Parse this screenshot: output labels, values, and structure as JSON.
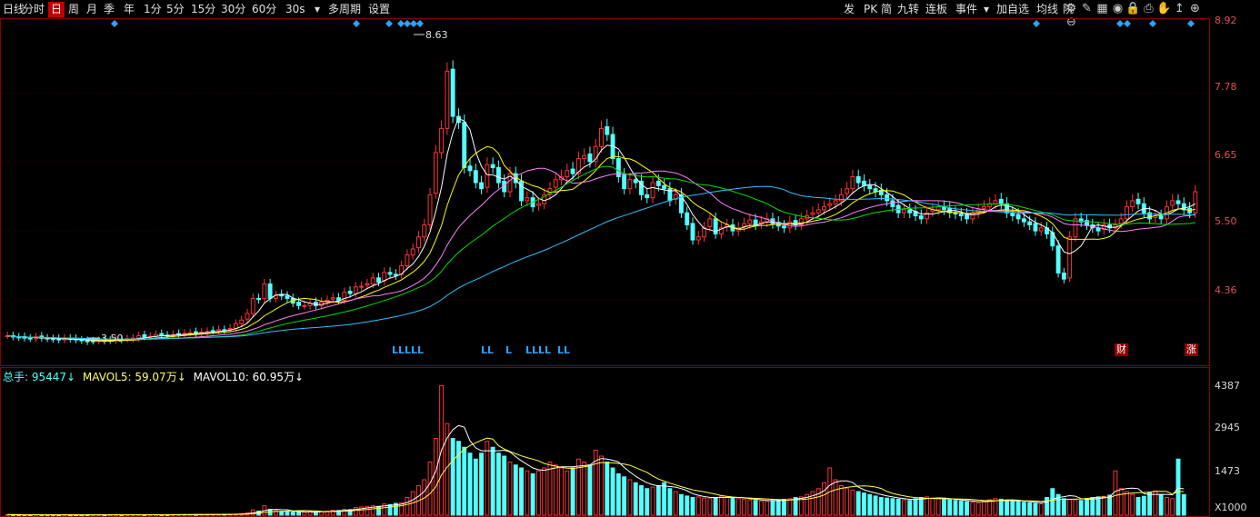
{
  "toolbar": {
    "items": [
      "日线",
      "分时",
      "日",
      "周",
      "月",
      "季",
      "年",
      "1分",
      "5分",
      "15分",
      "30分",
      "60分",
      "30s",
      "多周期",
      "设置"
    ],
    "active_index": 2,
    "right_items": [
      "发",
      "PK",
      "简",
      "九转",
      "连板",
      "事件",
      "加自选",
      "均线",
      "院"
    ]
  },
  "price_axis": {
    "labels": [
      "8.92",
      "7.78",
      "6.65",
      "5.50",
      "4.36"
    ]
  },
  "volume_axis": {
    "labels": [
      "4387",
      "2945",
      "1473",
      "X1000"
    ]
  },
  "volume_legend": {
    "total_label": "总手: 95447↓",
    "mavol5_label": "MAVOL5: 59.07万↓",
    "mavol10_label": "MAVOL10: 60.95万↓"
  },
  "annotations": {
    "high_label": "8.63",
    "low_label": "3.50",
    "ll_groups": [
      "LLLLL",
      "LL",
      "L",
      "LLLL",
      "LL"
    ],
    "tag_finance": "财",
    "tag_up": "涨"
  },
  "colors": {
    "up": "#ff3333",
    "down": "#54ffff",
    "ma5": "#ffffff",
    "ma10": "#ffff00",
    "ma20": "#ff80ff",
    "ma30": "#00e000",
    "ma60": "#30c0ff",
    "frame": "#8b0000"
  },
  "chart_data": {
    "type": "candlestick",
    "price_range": [
      3.3,
      9.0
    ],
    "volume_range": [
      0,
      4400
    ],
    "volume_unit": "X1000",
    "closes": [
      3.76,
      3.74,
      3.73,
      3.72,
      3.71,
      3.74,
      3.72,
      3.71,
      3.7,
      3.69,
      3.72,
      3.7,
      3.69,
      3.68,
      3.66,
      3.67,
      3.68,
      3.67,
      3.68,
      3.7,
      3.69,
      3.71,
      3.72,
      3.76,
      3.74,
      3.75,
      3.78,
      3.77,
      3.76,
      3.78,
      3.79,
      3.8,
      3.81,
      3.8,
      3.82,
      3.83,
      3.84,
      3.86,
      3.85,
      3.88,
      3.96,
      4.02,
      4.13,
      4.38,
      4.36,
      4.62,
      4.38,
      4.43,
      4.42,
      4.38,
      4.3,
      4.26,
      4.26,
      4.3,
      4.26,
      4.32,
      4.35,
      4.39,
      4.35,
      4.48,
      4.46,
      4.57,
      4.58,
      4.62,
      4.72,
      4.65,
      4.81,
      4.78,
      4.76,
      4.92,
      5.1,
      5.2,
      5.4,
      5.6,
      6.1,
      6.8,
      7.2,
      8.15,
      7.4,
      7.3,
      6.55,
      6.5,
      6.3,
      6.2,
      6.6,
      6.55,
      6.3,
      6.15,
      6.45,
      6.3,
      6.0,
      6.05,
      5.9,
      5.95,
      6.1,
      6.2,
      6.35,
      6.4,
      6.5,
      6.45,
      6.7,
      6.75,
      6.65,
      6.9,
      7.2,
      7.1,
      6.7,
      6.4,
      6.2,
      6.35,
      6.3,
      6.1,
      6.05,
      6.3,
      6.25,
      6.2,
      6.0,
      6.1,
      5.8,
      5.6,
      5.35,
      5.4,
      5.55,
      5.7,
      5.45,
      5.55,
      5.6,
      5.5,
      5.55,
      5.62,
      5.68,
      5.6,
      5.65,
      5.7,
      5.62,
      5.58,
      5.55,
      5.65,
      5.6,
      5.7,
      5.75,
      5.8,
      5.85,
      5.9,
      5.95,
      6.0,
      6.1,
      6.2,
      6.4,
      6.3,
      6.25,
      6.2,
      6.15,
      6.1,
      6.0,
      5.9,
      5.8,
      5.85,
      5.8,
      5.75,
      5.7,
      5.8,
      5.85,
      5.9,
      5.85,
      5.8,
      5.78,
      5.75,
      5.7,
      5.8,
      5.85,
      5.9,
      5.95,
      6.0,
      5.95,
      5.8,
      5.75,
      5.7,
      5.65,
      5.6,
      5.5,
      5.55,
      5.45,
      5.25,
      4.8,
      4.7,
      5.4,
      5.7,
      5.65,
      5.6,
      5.55,
      5.5,
      5.6,
      5.55,
      5.6,
      5.7,
      5.9,
      6.0,
      5.95,
      5.8,
      5.7,
      5.75,
      5.7,
      5.9,
      6.0,
      5.95,
      5.85,
      5.8,
      6.15
    ],
    "volumes": [
      20,
      18,
      15,
      14,
      16,
      13,
      15,
      12,
      14,
      11,
      13,
      12,
      14,
      15,
      16,
      13,
      14,
      12,
      15,
      16,
      14,
      13,
      15,
      18,
      16,
      15,
      17,
      16,
      18,
      19,
      20,
      21,
      22,
      23,
      25,
      24,
      26,
      28,
      30,
      35,
      40,
      55,
      80,
      180,
      140,
      320,
      200,
      150,
      130,
      120,
      110,
      100,
      105,
      120,
      110,
      130,
      140,
      170,
      160,
      200,
      190,
      260,
      280,
      300,
      320,
      300,
      380,
      360,
      400,
      420,
      600,
      800,
      1000,
      1200,
      1800,
      2600,
      4387,
      3100,
      2600,
      2500,
      2300,
      2100,
      1900,
      2100,
      2500,
      2300,
      2100,
      2000,
      1800,
      1700,
      1600,
      1500,
      1400,
      1500,
      1600,
      1800,
      1700,
      1600,
      1500,
      1600,
      1900,
      1800,
      1700,
      2200,
      2000,
      1800,
      1600,
      1400,
      1300,
      1200,
      1100,
      1000,
      900,
      950,
      1000,
      1100,
      900,
      800,
      700,
      650,
      600,
      620,
      580,
      560,
      600,
      640,
      620,
      580,
      560,
      540,
      520,
      500,
      480,
      460,
      500,
      520,
      540,
      560,
      600,
      620,
      700,
      800,
      900,
      1100,
      1600,
      1200,
      1000,
      900,
      850,
      800,
      750,
      700,
      650,
      600,
      580,
      560,
      540,
      520,
      500,
      560,
      600,
      620,
      580,
      560,
      540,
      520,
      500,
      480,
      460,
      440,
      420,
      480,
      520,
      560,
      540,
      500,
      480,
      460,
      440,
      420,
      400,
      380,
      600,
      900,
      700,
      560,
      540,
      520,
      500,
      560,
      600,
      620,
      640,
      680,
      1500,
      900,
      800,
      700,
      600,
      640,
      760,
      820,
      700,
      600,
      560,
      1900,
      700
    ]
  }
}
